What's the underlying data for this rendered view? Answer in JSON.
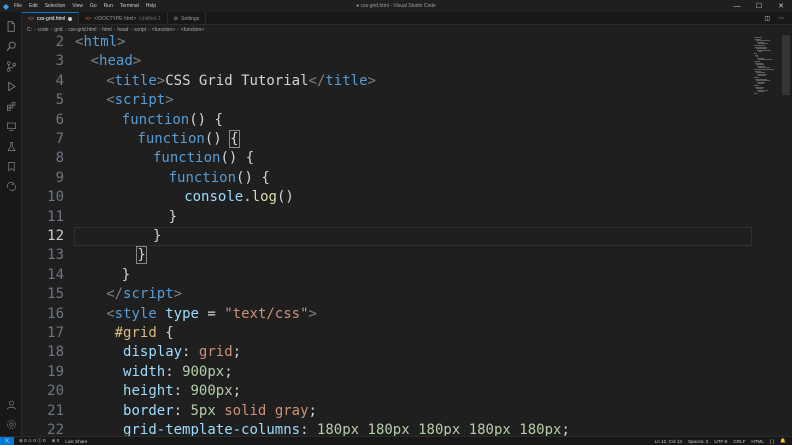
{
  "window": {
    "title": "● css-grid.html - Visual Studio Code",
    "menu": [
      "File",
      "Edit",
      "Selection",
      "View",
      "Go",
      "Run",
      "Terminal",
      "Help"
    ],
    "controls": [
      "minimize-icon",
      "maximize-icon",
      "close-icon"
    ]
  },
  "activity_bar": [
    "explorer-icon",
    "search-icon",
    "source-control-icon",
    "run-debug-icon",
    "extensions-icon",
    "remote-explorer-icon",
    "testing-icon",
    "bookmarks-icon",
    "live-share-icon",
    "accounts-icon",
    "manage-icon"
  ],
  "tabs": [
    {
      "label": "css-grid.html",
      "active": true,
      "modified": true,
      "icon": "html-file-icon"
    },
    {
      "label": "<!DOCTYPE html>",
      "suffix": "Untitled-1",
      "active": false,
      "icon": "html-file-icon"
    },
    {
      "label": "Settings",
      "active": false,
      "icon": "gear-icon"
    }
  ],
  "breadcrumb": [
    "C:",
    "code",
    "grid",
    "css-grid.html",
    "html",
    "head",
    "script",
    "<function>",
    "<function>"
  ],
  "editor": {
    "current_line": 12,
    "lines": [
      {
        "n": "2",
        "indent": 0,
        "tokens": [
          [
            "t-punct",
            "<"
          ],
          [
            "t-tag",
            "html"
          ],
          [
            "t-punct",
            ">"
          ]
        ]
      },
      {
        "n": "3",
        "indent": 1,
        "tokens": [
          [
            "t-punct",
            "<"
          ],
          [
            "t-tag",
            "head"
          ],
          [
            "t-punct",
            ">"
          ]
        ]
      },
      {
        "n": "4",
        "indent": 2,
        "tokens": [
          [
            "t-punct",
            "<"
          ],
          [
            "t-tag",
            "title"
          ],
          [
            "t-punct",
            ">"
          ],
          [
            "t-text",
            "CSS Grid Tutorial"
          ],
          [
            "t-punct",
            "</"
          ],
          [
            "t-tag",
            "title"
          ],
          [
            "t-punct",
            ">"
          ]
        ]
      },
      {
        "n": "5",
        "indent": 2,
        "tokens": [
          [
            "t-punct",
            "<"
          ],
          [
            "t-tag",
            "script"
          ],
          [
            "t-punct",
            ">"
          ]
        ]
      },
      {
        "n": "6",
        "indent": 3,
        "tokens": [
          [
            "t-kw",
            "function"
          ],
          [
            "t-text",
            "() {"
          ]
        ]
      },
      {
        "n": "7",
        "indent": 4,
        "tokens": [
          [
            "t-kw",
            "function"
          ],
          [
            "t-text",
            "() "
          ],
          [
            "t-text bracket-box",
            "{"
          ]
        ]
      },
      {
        "n": "8",
        "indent": 5,
        "tokens": [
          [
            "t-kw",
            "function"
          ],
          [
            "t-text",
            "() {"
          ]
        ]
      },
      {
        "n": "9",
        "indent": 6,
        "tokens": [
          [
            "t-kw",
            "function"
          ],
          [
            "t-text",
            "() {"
          ]
        ]
      },
      {
        "n": "10",
        "indent": 7,
        "tokens": [
          [
            "t-var",
            "console"
          ],
          [
            "t-text",
            "."
          ],
          [
            "t-fn",
            "log"
          ],
          [
            "t-text",
            "()"
          ]
        ]
      },
      {
        "n": "11",
        "indent": 6,
        "tokens": [
          [
            "t-text",
            "}"
          ]
        ]
      },
      {
        "n": "12",
        "indent": 5,
        "tokens": [
          [
            "t-text",
            "}"
          ]
        ]
      },
      {
        "n": "13",
        "indent": 4,
        "tokens": [
          [
            "t-text bracket-box",
            "}"
          ]
        ]
      },
      {
        "n": "14",
        "indent": 3,
        "tokens": [
          [
            "t-text",
            "}"
          ]
        ]
      },
      {
        "n": "15",
        "indent": 2,
        "tokens": [
          [
            "t-punct",
            "</"
          ],
          [
            "t-tag",
            "script"
          ],
          [
            "t-punct",
            ">"
          ]
        ]
      },
      {
        "n": "16",
        "indent": 2,
        "tokens": [
          [
            "t-punct",
            "<"
          ],
          [
            "t-tag",
            "style"
          ],
          [
            "t-text",
            " "
          ],
          [
            "t-attr",
            "type"
          ],
          [
            "t-text",
            " = "
          ],
          [
            "t-str",
            "\"text/css\""
          ],
          [
            "t-punct",
            ">"
          ]
        ]
      },
      {
        "n": "17",
        "indent": 2,
        "tokens": [
          [
            "t-sel",
            " #grid"
          ],
          [
            "t-text",
            " {"
          ]
        ]
      },
      {
        "n": "18",
        "indent": 2,
        "tokens": [
          [
            "t-prop",
            "  display"
          ],
          [
            "t-text",
            ": "
          ],
          [
            "t-val",
            "grid"
          ],
          [
            "t-text",
            ";"
          ]
        ]
      },
      {
        "n": "19",
        "indent": 2,
        "tokens": [
          [
            "t-prop",
            "  width"
          ],
          [
            "t-text",
            ": "
          ],
          [
            "t-num",
            "900px"
          ],
          [
            "t-text",
            ";"
          ]
        ]
      },
      {
        "n": "20",
        "indent": 2,
        "tokens": [
          [
            "t-prop",
            "  height"
          ],
          [
            "t-text",
            ": "
          ],
          [
            "t-num",
            "900px"
          ],
          [
            "t-text",
            ";"
          ]
        ]
      },
      {
        "n": "21",
        "indent": 2,
        "tokens": [
          [
            "t-prop",
            "  border"
          ],
          [
            "t-text",
            ": "
          ],
          [
            "t-num",
            "5px"
          ],
          [
            "t-text",
            " "
          ],
          [
            "t-val",
            "solid"
          ],
          [
            "t-text",
            " "
          ],
          [
            "t-val",
            "gray"
          ],
          [
            "t-text",
            ";"
          ]
        ]
      },
      {
        "n": "22",
        "indent": 2,
        "tokens": [
          [
            "t-prop",
            "  grid-template-columns"
          ],
          [
            "t-text",
            ": "
          ],
          [
            "t-num",
            "180px"
          ],
          [
            "t-text",
            " "
          ],
          [
            "t-num",
            "180px"
          ],
          [
            "t-text",
            " "
          ],
          [
            "t-num",
            "180px"
          ],
          [
            "t-text",
            " "
          ],
          [
            "t-num",
            "180px"
          ],
          [
            "t-text",
            " "
          ],
          [
            "t-num",
            "180px"
          ],
          [
            "t-text",
            ";"
          ]
        ]
      }
    ]
  },
  "statusbar": {
    "left": [
      "⊗ 0 ⚠ 0 ⓘ 0",
      "⊗ 0",
      "Live Share"
    ],
    "right": [
      "Ln 12, Col 13",
      "Spaces: 2",
      "UTF-8",
      "CRLF",
      "HTML",
      "{ }",
      "🔔"
    ]
  }
}
